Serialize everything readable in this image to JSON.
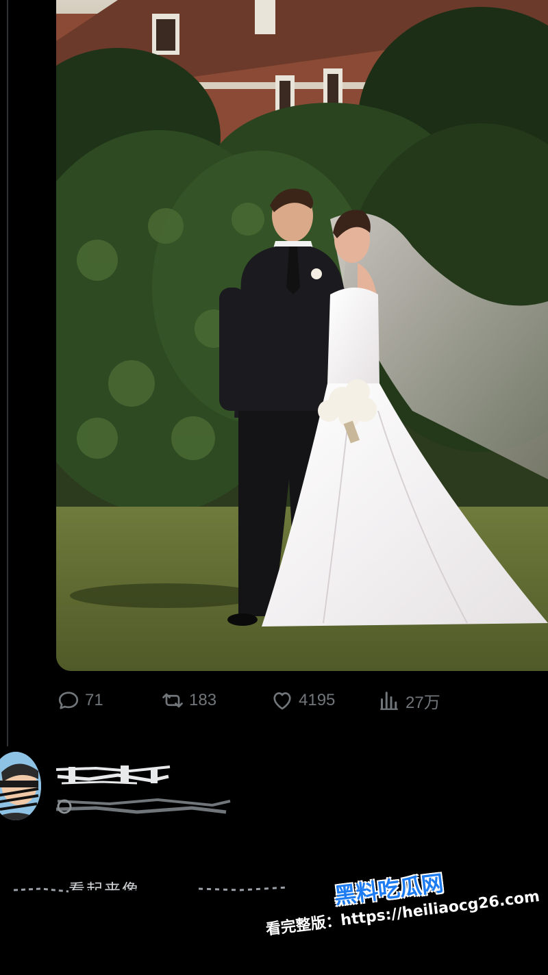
{
  "post": {
    "photo_alt": "wedding photo",
    "actions": {
      "reply_count": "71",
      "retweet_count": "183",
      "like_count": "4195",
      "view_count": "27万"
    },
    "icons": {
      "reply": "comment-icon",
      "retweet": "retweet-icon",
      "like": "heart-icon",
      "views": "analytics-icon"
    }
  },
  "reply": {
    "text": "看起来像"
  },
  "watermark": {
    "brand": "黑料吃瓜网",
    "label": "看完整版：",
    "url": "https://heiliaocg26.com"
  },
  "colors": {
    "background": "#000000",
    "muted": "#71767b",
    "watermark_blue": "#1d7cf2"
  }
}
